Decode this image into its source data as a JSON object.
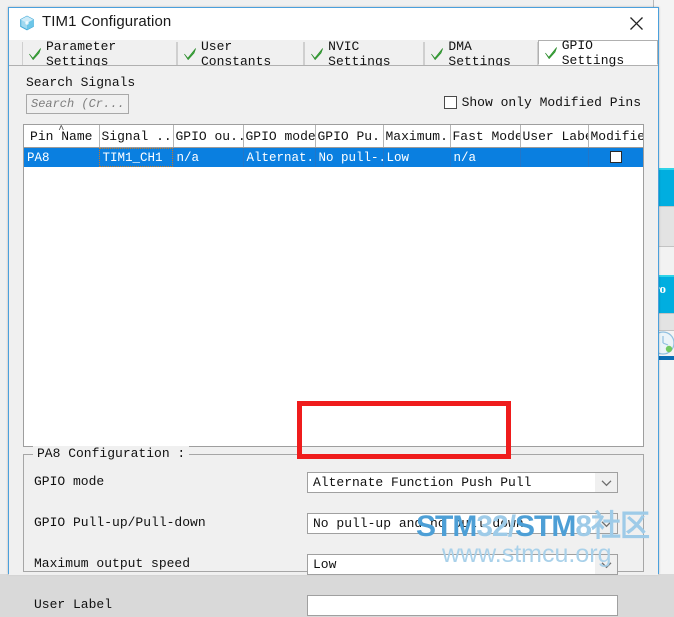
{
  "window": {
    "title": "TIM1 Configuration",
    "icon": "stm-cube-icon",
    "close_label": "✕"
  },
  "tabs": [
    {
      "label": "Parameter Settings",
      "icon": "green-check-icon",
      "active": false
    },
    {
      "label": "User Constants",
      "icon": "green-check-icon",
      "active": false
    },
    {
      "label": "NVIC Settings",
      "icon": "green-check-icon",
      "active": false
    },
    {
      "label": "DMA Settings",
      "icon": "green-check-icon",
      "active": false
    },
    {
      "label": "GPIO Settings",
      "icon": "green-check-icon",
      "active": true
    }
  ],
  "search": {
    "label": "Search Signals",
    "placeholder": "Search (Cr...",
    "value": ""
  },
  "show_modified": {
    "label": "Show only Modified Pins",
    "checked": false
  },
  "table": {
    "columns": [
      "Pin Name",
      "Signal ...",
      "GPIO ou...",
      "GPIO mode",
      "GPIO Pu...",
      "Maximum...",
      "Fast Mode",
      "User Label",
      "Modified"
    ],
    "sort_column": "Pin Name",
    "sort_caret": "˄",
    "rows": [
      {
        "pin_name": "PA8",
        "signal": "TIM1_CH1",
        "gpio_output": "n/a",
        "gpio_mode": "Alternat...",
        "gpio_pull": "No pull-...",
        "maximum": "Low",
        "fast_mode": "n/a",
        "user_label": "",
        "modified": false,
        "selected": true,
        "focused_cell": "signal"
      }
    ]
  },
  "config": {
    "group_title": "PA8 Configuration :",
    "fields": [
      {
        "label": "GPIO mode",
        "value": "Alternate Function Push Pull",
        "type": "combo",
        "highlighted": true
      },
      {
        "label": "GPIO Pull-up/Pull-down",
        "value": "No pull-up and no pull-down",
        "type": "combo",
        "highlighted": false
      },
      {
        "label": "Maximum output speed",
        "value": "Low",
        "type": "combo",
        "highlighted": false
      },
      {
        "label": "User Label",
        "value": "",
        "type": "text",
        "highlighted": false
      }
    ]
  },
  "annotation": {
    "shape": "rectangle",
    "color": "#ef1c1c",
    "targets": "gpio-mode-combo"
  },
  "watermark": {
    "line1_a": "STM",
    "line1_b": "32/",
    "line1_c": "STM",
    "line1_d": "8社区",
    "line2": "www.stmcu.org"
  },
  "background_app": {
    "visible_text": "ro"
  },
  "colors": {
    "accent_blue": "#0a7fe0",
    "window_border": "#4ba0dc",
    "annotation_red": "#ef1c1c",
    "check_green": "#3fae3f"
  }
}
